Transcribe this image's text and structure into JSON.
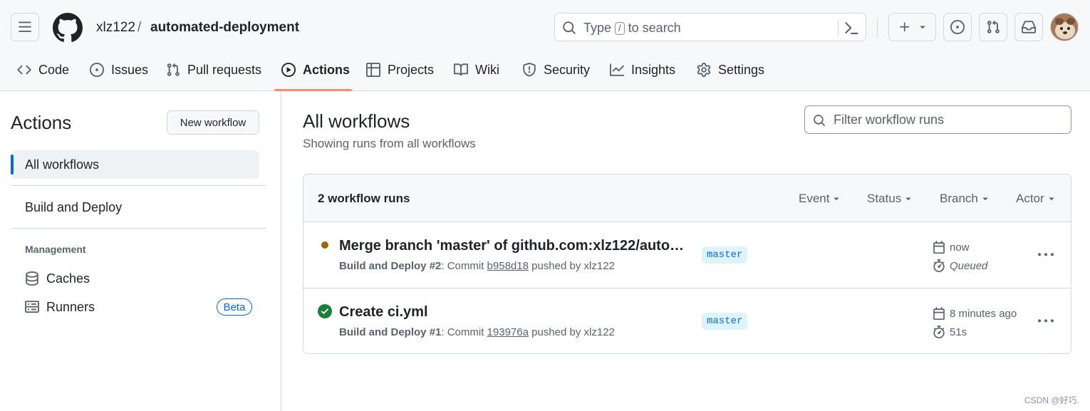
{
  "header": {
    "owner": "xlz122",
    "separator": "/",
    "repo": "automated-deployment",
    "search": {
      "prefix": "Type",
      "key": "/",
      "suffix": "to search"
    }
  },
  "tabs": [
    {
      "label": "Code",
      "icon": "code-icon"
    },
    {
      "label": "Issues",
      "icon": "issue-icon"
    },
    {
      "label": "Pull requests",
      "icon": "pull-request-icon"
    },
    {
      "label": "Actions",
      "icon": "play-icon",
      "active": true
    },
    {
      "label": "Projects",
      "icon": "table-icon"
    },
    {
      "label": "Wiki",
      "icon": "book-icon"
    },
    {
      "label": "Security",
      "icon": "shield-icon"
    },
    {
      "label": "Insights",
      "icon": "graph-icon"
    },
    {
      "label": "Settings",
      "icon": "gear-icon"
    }
  ],
  "sidebar": {
    "title": "Actions",
    "new_workflow": "New workflow",
    "items": [
      {
        "label": "All workflows",
        "active": true
      },
      {
        "label": "Build and Deploy"
      }
    ],
    "management_heading": "Management",
    "management": [
      {
        "label": "Caches",
        "icon": "database-icon"
      },
      {
        "label": "Runners",
        "icon": "server-icon",
        "badge": "Beta"
      }
    ]
  },
  "main": {
    "title": "All workflows",
    "subtitle": "Showing runs from all workflows",
    "filter_placeholder": "Filter workflow runs",
    "runs_count": "2 workflow runs",
    "filters": [
      "Event",
      "Status",
      "Branch",
      "Actor"
    ],
    "runs": [
      {
        "status": "queued",
        "title": "Merge branch 'master' of github.com:xlz122/autom...",
        "workflow": "Build and Deploy",
        "run_number": "#2",
        "meta_commit": ": Commit",
        "sha": "b958d18",
        "meta_by": "pushed by xlz122",
        "branch": "master",
        "time": "now",
        "duration": "Queued"
      },
      {
        "status": "success",
        "title": "Create ci.yml",
        "workflow": "Build and Deploy",
        "run_number": "#1",
        "meta_commit": ": Commit",
        "sha": "193976a",
        "meta_by": "pushed by xlz122",
        "branch": "master",
        "time": "8 minutes ago",
        "duration": "51s"
      }
    ]
  },
  "colors": {
    "accent": "#0969da",
    "tab_underline": "#fd8c73",
    "queued": "#9a6700",
    "success": "#1a7f37"
  },
  "watermark": "CSDN @好巧."
}
